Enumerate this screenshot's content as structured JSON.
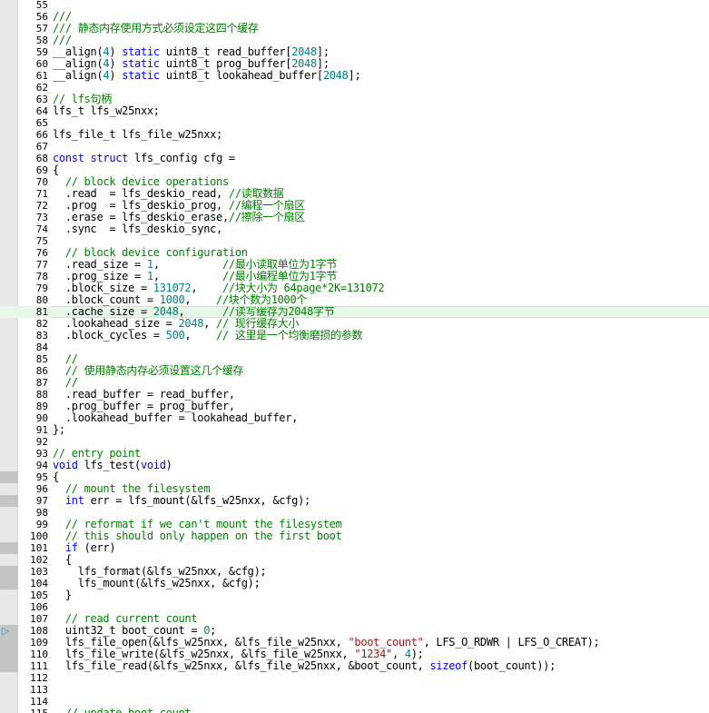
{
  "lines": [
    {
      "n": "55",
      "tok": []
    },
    {
      "n": "56",
      "tok": [
        {
          "t": "///",
          "c": "cm"
        }
      ]
    },
    {
      "n": "57",
      "tok": [
        {
          "t": "/// 静态内存使用方式必须设定这四个缓存",
          "c": "cm"
        }
      ]
    },
    {
      "n": "58",
      "tok": [
        {
          "t": "///",
          "c": "cm"
        }
      ]
    },
    {
      "n": "59",
      "tok": [
        {
          "t": "__align(",
          "c": "tx"
        },
        {
          "t": "4",
          "c": "nm"
        },
        {
          "t": ") ",
          "c": "tx"
        },
        {
          "t": "static",
          "c": "kw"
        },
        {
          "t": " uint8_t read_buffer[",
          "c": "tx"
        },
        {
          "t": "2048",
          "c": "nm"
        },
        {
          "t": "];",
          "c": "tx"
        }
      ]
    },
    {
      "n": "60",
      "tok": [
        {
          "t": "__align(",
          "c": "tx"
        },
        {
          "t": "4",
          "c": "nm"
        },
        {
          "t": ") ",
          "c": "tx"
        },
        {
          "t": "static",
          "c": "kw"
        },
        {
          "t": " uint8_t prog_buffer[",
          "c": "tx"
        },
        {
          "t": "2048",
          "c": "nm"
        },
        {
          "t": "];",
          "c": "tx"
        }
      ]
    },
    {
      "n": "61",
      "tok": [
        {
          "t": "__align(",
          "c": "tx"
        },
        {
          "t": "4",
          "c": "nm"
        },
        {
          "t": ") ",
          "c": "tx"
        },
        {
          "t": "static",
          "c": "kw"
        },
        {
          "t": " uint8_t lookahead_buffer[",
          "c": "tx"
        },
        {
          "t": "2048",
          "c": "nm"
        },
        {
          "t": "];",
          "c": "tx"
        }
      ]
    },
    {
      "n": "62",
      "tok": []
    },
    {
      "n": "63",
      "tok": [
        {
          "t": "// lfs句柄",
          "c": "cm"
        }
      ]
    },
    {
      "n": "64",
      "tok": [
        {
          "t": "lfs_t lfs_w25nxx;",
          "c": "tx"
        }
      ]
    },
    {
      "n": "65",
      "tok": []
    },
    {
      "n": "66",
      "tok": [
        {
          "t": "lfs_file_t lfs_file_w25nxx;",
          "c": "tx"
        }
      ]
    },
    {
      "n": "67",
      "tok": []
    },
    {
      "n": "68",
      "tok": [
        {
          "t": "const",
          "c": "kw"
        },
        {
          "t": " ",
          "c": "tx"
        },
        {
          "t": "struct",
          "c": "kw"
        },
        {
          "t": " lfs_config cfg =",
          "c": "tx"
        }
      ]
    },
    {
      "n": "69",
      "tok": [
        {
          "t": "{",
          "c": "tx"
        }
      ]
    },
    {
      "n": "70",
      "tok": [
        {
          "t": "  // block device operations",
          "c": "cm"
        }
      ]
    },
    {
      "n": "71",
      "tok": [
        {
          "t": "  .read  = lfs_deskio_read, ",
          "c": "tx"
        },
        {
          "t": "//读取数据",
          "c": "cm"
        }
      ]
    },
    {
      "n": "72",
      "tok": [
        {
          "t": "  .prog  = lfs_deskio_prog, ",
          "c": "tx"
        },
        {
          "t": "//编程一个扇区",
          "c": "cm"
        }
      ]
    },
    {
      "n": "73",
      "tok": [
        {
          "t": "  .erase = lfs_deskio_erase,",
          "c": "tx"
        },
        {
          "t": "//擦除一个扇区",
          "c": "cm"
        }
      ]
    },
    {
      "n": "74",
      "tok": [
        {
          "t": "  .sync  = lfs_deskio_sync,",
          "c": "tx"
        }
      ]
    },
    {
      "n": "75",
      "tok": []
    },
    {
      "n": "76",
      "tok": [
        {
          "t": "  // block device configuration",
          "c": "cm"
        }
      ]
    },
    {
      "n": "77",
      "tok": [
        {
          "t": "  .read_size = ",
          "c": "tx"
        },
        {
          "t": "1",
          "c": "nm"
        },
        {
          "t": ",          ",
          "c": "tx"
        },
        {
          "t": "//最小读取单位为1字节",
          "c": "cm"
        }
      ]
    },
    {
      "n": "78",
      "tok": [
        {
          "t": "  .prog_size = ",
          "c": "tx"
        },
        {
          "t": "1",
          "c": "nm"
        },
        {
          "t": ",          ",
          "c": "tx"
        },
        {
          "t": "//最小编程单位为1字节",
          "c": "cm"
        }
      ]
    },
    {
      "n": "79",
      "tok": [
        {
          "t": "  .block_size = ",
          "c": "tx"
        },
        {
          "t": "131072",
          "c": "nm"
        },
        {
          "t": ",    ",
          "c": "tx"
        },
        {
          "t": "//块大小为 64page*2K=131072",
          "c": "cm"
        }
      ]
    },
    {
      "n": "80",
      "tok": [
        {
          "t": "  .block_count = ",
          "c": "tx"
        },
        {
          "t": "1000",
          "c": "nm"
        },
        {
          "t": ",    ",
          "c": "tx"
        },
        {
          "t": "//块个数为1000个",
          "c": "cm"
        }
      ]
    },
    {
      "n": "81",
      "current": true,
      "tok": [
        {
          "t": "  .cache_size = ",
          "c": "tx"
        },
        {
          "t": "2048",
          "c": "nm"
        },
        {
          "t": ",      ",
          "c": "tx"
        },
        {
          "t": "//读写缓存为2048字节",
          "c": "cm"
        }
      ]
    },
    {
      "n": "82",
      "tok": [
        {
          "t": "  .lookahead_size = ",
          "c": "tx"
        },
        {
          "t": "2048",
          "c": "nm"
        },
        {
          "t": ", ",
          "c": "tx"
        },
        {
          "t": "// 现行缓存大小",
          "c": "cm"
        }
      ]
    },
    {
      "n": "83",
      "tok": [
        {
          "t": "  .block_cycles = ",
          "c": "tx"
        },
        {
          "t": "500",
          "c": "nm"
        },
        {
          "t": ",    ",
          "c": "tx"
        },
        {
          "t": "// 这里是一个均衡磨损的参数",
          "c": "cm"
        }
      ]
    },
    {
      "n": "84",
      "tok": []
    },
    {
      "n": "85",
      "tok": [
        {
          "t": "  //",
          "c": "cm"
        }
      ]
    },
    {
      "n": "86",
      "tok": [
        {
          "t": "  // 使用静态内存必须设置这几个缓存",
          "c": "cm"
        }
      ]
    },
    {
      "n": "87",
      "tok": [
        {
          "t": "  //",
          "c": "cm"
        }
      ]
    },
    {
      "n": "88",
      "tok": [
        {
          "t": "  .read_buffer = read_buffer,",
          "c": "tx"
        }
      ]
    },
    {
      "n": "89",
      "tok": [
        {
          "t": "  .prog_buffer = prog_buffer,",
          "c": "tx"
        }
      ]
    },
    {
      "n": "90",
      "tok": [
        {
          "t": "  .lookahead_buffer = lookahead_buffer,",
          "c": "tx"
        }
      ]
    },
    {
      "n": "91",
      "tok": [
        {
          "t": "};",
          "c": "tx"
        }
      ]
    },
    {
      "n": "92",
      "tok": []
    },
    {
      "n": "93",
      "tok": [
        {
          "t": "// entry point",
          "c": "cm"
        }
      ]
    },
    {
      "n": "94",
      "tok": [
        {
          "t": "void",
          "c": "kw"
        },
        {
          "t": " lfs_test(",
          "c": "tx"
        },
        {
          "t": "void",
          "c": "kw"
        },
        {
          "t": ")",
          "c": "tx"
        }
      ]
    },
    {
      "n": "95",
      "mark": true,
      "tok": [
        {
          "t": "{",
          "c": "tx"
        }
      ]
    },
    {
      "n": "96",
      "tok": [
        {
          "t": "  // mount the filesystem",
          "c": "cm"
        }
      ]
    },
    {
      "n": "97",
      "mark": true,
      "tok": [
        {
          "t": "  ",
          "c": "tx"
        },
        {
          "t": "int",
          "c": "kw"
        },
        {
          "t": " err = lfs_mount(&lfs_w25nxx, &cfg);",
          "c": "tx"
        }
      ]
    },
    {
      "n": "98",
      "tok": []
    },
    {
      "n": "99",
      "tok": [
        {
          "t": "  // reformat if we can't mount the filesystem",
          "c": "cm"
        }
      ]
    },
    {
      "n": "100",
      "tok": [
        {
          "t": "  // this should only happen on the first boot",
          "c": "cm"
        }
      ]
    },
    {
      "n": "101",
      "mark": true,
      "tok": [
        {
          "t": "  ",
          "c": "tx"
        },
        {
          "t": "if",
          "c": "kw"
        },
        {
          "t": " (err)",
          "c": "tx"
        }
      ]
    },
    {
      "n": "102",
      "tok": [
        {
          "t": "  {",
          "c": "tx"
        }
      ]
    },
    {
      "n": "103",
      "mark": true,
      "tok": [
        {
          "t": "    lfs_format(&lfs_w25nxx, &cfg);",
          "c": "tx"
        }
      ]
    },
    {
      "n": "104",
      "mark": true,
      "tok": [
        {
          "t": "    lfs_mount(&lfs_w25nxx, &cfg);",
          "c": "tx"
        }
      ]
    },
    {
      "n": "105",
      "tok": [
        {
          "t": "  }",
          "c": "tx"
        }
      ]
    },
    {
      "n": "106",
      "tok": []
    },
    {
      "n": "107",
      "tok": [
        {
          "t": "  // read current count",
          "c": "cm"
        }
      ]
    },
    {
      "n": "108",
      "mark": true,
      "arrow": true,
      "tok": [
        {
          "t": "  uint32_t boot_count = ",
          "c": "tx"
        },
        {
          "t": "0",
          "c": "nm"
        },
        {
          "t": ";",
          "c": "tx"
        }
      ]
    },
    {
      "n": "109",
      "mark": true,
      "tok": [
        {
          "t": "  lfs_file_open(&lfs_w25nxx, &lfs_file_w25nxx, ",
          "c": "tx"
        },
        {
          "t": "\"boot_count\"",
          "c": "st"
        },
        {
          "t": ", LFS_O_RDWR | LFS_O_CREAT);",
          "c": "tx"
        }
      ]
    },
    {
      "n": "110",
      "mark": true,
      "tok": [
        {
          "t": "  lfs_file_write(&lfs_w25nxx, &lfs_file_w25nxx, ",
          "c": "tx"
        },
        {
          "t": "\"1234\"",
          "c": "st"
        },
        {
          "t": ", ",
          "c": "tx"
        },
        {
          "t": "4",
          "c": "nm"
        },
        {
          "t": ");",
          "c": "tx"
        }
      ]
    },
    {
      "n": "111",
      "mark": true,
      "tok": [
        {
          "t": "  lfs_file_read(&lfs_w25nxx, &lfs_file_w25nxx, &boot_count, ",
          "c": "tx"
        },
        {
          "t": "sizeof",
          "c": "kw"
        },
        {
          "t": "(boot_count));",
          "c": "tx"
        }
      ]
    },
    {
      "n": "112",
      "tok": []
    },
    {
      "n": "113",
      "tok": []
    },
    {
      "n": "114",
      "tok": []
    },
    {
      "n": "115",
      "tok": [
        {
          "t": "  // update boot count",
          "c": "cm"
        }
      ]
    }
  ],
  "colors": {
    "comment": "#008000",
    "keyword": "#0000ff",
    "number": "#008080",
    "string": "#a31515",
    "text": "#000000",
    "gutter": "#e8e8e8",
    "breakpoint_mark": "#c4c4c4",
    "current_line": "#e8f8e8",
    "exec_arrow": "#3aa0c0"
  },
  "icons": {
    "exec_arrow": "execution-pointer-icon"
  }
}
